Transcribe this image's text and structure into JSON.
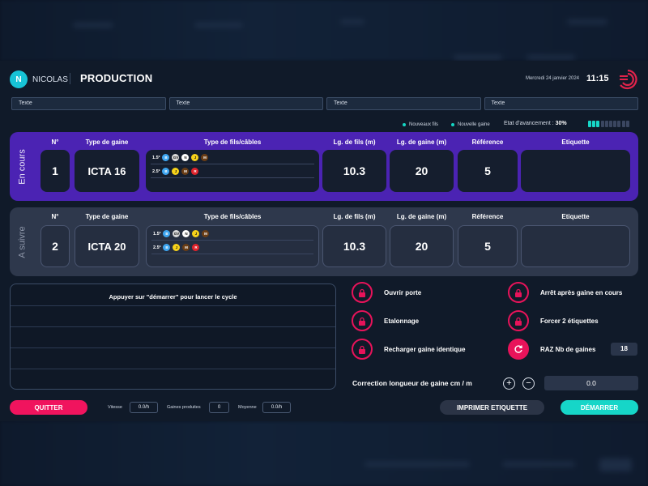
{
  "header": {
    "avatar_letter": "N",
    "user_name": "NICOLAS",
    "title": "PRODUCTION",
    "date": "Mercredi 24 janvier 2024",
    "time": "11:15"
  },
  "text_fields": [
    {
      "value": "Texte"
    },
    {
      "value": "Texte"
    },
    {
      "value": "Texte"
    },
    {
      "value": "Texte"
    }
  ],
  "legend": {
    "new_wires": "Nouveaux fils",
    "new_sheath": "Nouvelle gaine",
    "color": "#14d7c4"
  },
  "progress": {
    "label": "Etat d'avancement :",
    "value_text": "30%",
    "value": 0.3,
    "filled_color": "#16d6c8",
    "empty_color": "#3a4660"
  },
  "columns": {
    "num": "N°",
    "sheath_type": "Type de gaine",
    "wire_type": "Type de fils/câbles",
    "wire_length": "Lg. de fils (m)",
    "sheath_length": "Lg. de gaine (m)",
    "reference": "Référence",
    "label": "Etiquette"
  },
  "current": {
    "section_label": "En cours",
    "num": "1",
    "sheath_type": "ICTA 16",
    "wires": [
      {
        "size": "1.5²",
        "dots": [
          "B",
          "GV",
          "N",
          "J",
          "M"
        ]
      },
      {
        "size": "2.5²",
        "dots": [
          "B",
          "J",
          "M",
          "R"
        ]
      }
    ],
    "wire_length": "10.3",
    "sheath_length": "20",
    "reference": "5",
    "label": "",
    "color": "#4b23b3"
  },
  "next": {
    "section_label": "A suivre",
    "num": "2",
    "sheath_type": "ICTA 20",
    "wires": [
      {
        "size": "1.5²",
        "dots": [
          "B",
          "GV",
          "N",
          "J",
          "M"
        ]
      },
      {
        "size": "2.5²",
        "dots": [
          "B",
          "J",
          "M",
          "R"
        ]
      }
    ],
    "wire_length": "10.3",
    "sheath_length": "20",
    "reference": "5",
    "label": ""
  },
  "log": {
    "message": "Appuyer sur \"démarrer\" pour lancer le cycle"
  },
  "options": {
    "open_door": "Ouvrir porte",
    "stop_after": "Arrêt après gaine en cours",
    "calibration": "Etalonnage",
    "force_labels": "Forcer 2 étiquettes",
    "reload_same": "Recharger gaine identique",
    "reset_count": "RAZ Nb de gaines",
    "reset_count_value": "18"
  },
  "correction": {
    "label": "Correction longueur de gaine cm / m",
    "plus": "+",
    "minus": "−",
    "value": "0.0"
  },
  "footer": {
    "quit": "QUITTER",
    "speed_label": "Vitesse",
    "speed_value": "0.0/h",
    "produced_label": "Gaines produites",
    "produced_value": "0",
    "average_label": "Moyenne",
    "average_value": "0.0/h",
    "print_label": "IMPRIMER ETIQUETTE",
    "start_label": "DÉMARRER"
  },
  "colors": {
    "accent_pink": "#f0145e",
    "accent_cyan": "#16d6c8",
    "current_panel": "#4b23b3",
    "next_panel": "#2e384c",
    "background": "#101a29"
  }
}
